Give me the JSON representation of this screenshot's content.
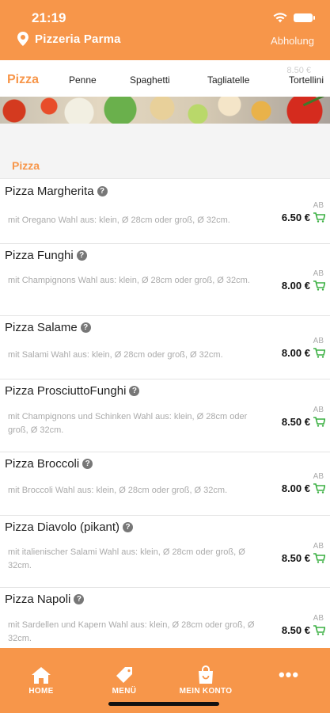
{
  "status_bar": {
    "time": "21:19"
  },
  "header": {
    "restaurant_name": "Pizzeria Parma",
    "pickup_label": "Abholung"
  },
  "tabs": {
    "ghost_price": "8.50 €",
    "items": [
      {
        "label": "Pizza"
      },
      {
        "label": "Penne"
      },
      {
        "label": "Spaghetti"
      },
      {
        "label": "Tagliatelle"
      },
      {
        "label": "Tortellini"
      }
    ]
  },
  "section": {
    "title": "Pizza"
  },
  "menu_items": [
    {
      "name": "Pizza Margherita",
      "description": "mit Oregano Wahl aus: klein, Ø 28cm oder groß, Ø 32cm.",
      "ab": "AB",
      "price": "6.50 €"
    },
    {
      "name": "Pizza Funghi",
      "description": "mit Champignons Wahl aus: klein, Ø 28cm oder groß, Ø 32cm.",
      "ab": "AB",
      "price": "8.00 €"
    },
    {
      "name": "Pizza Salame",
      "description": "mit Salami Wahl aus: klein, Ø 28cm oder groß, Ø 32cm.",
      "ab": "AB",
      "price": "8.00 €"
    },
    {
      "name": "Pizza ProsciuttoFunghi",
      "description": "mit Champignons und Schinken Wahl aus: klein, Ø 28cm oder groß, Ø 32cm.",
      "ab": "AB",
      "price": "8.50 €"
    },
    {
      "name": "Pizza Broccoli",
      "description": "mit Broccoli Wahl aus: klein, Ø 28cm oder groß, Ø 32cm.",
      "ab": "AB",
      "price": "8.00 €"
    },
    {
      "name": "Pizza Diavolo (pikant)",
      "description": "mit italienischer Salami Wahl aus: klein, Ø 28cm oder groß, Ø 32cm.",
      "ab": "AB",
      "price": "8.50 €"
    },
    {
      "name": "Pizza Napoli",
      "description": "mit Sardellen und Kapern Wahl aus: klein, Ø 28cm oder groß, Ø 32cm.",
      "ab": "AB",
      "price": "8.50 €"
    }
  ],
  "bottom_nav": {
    "home_label": "HOME",
    "menu_label": "MENÜ",
    "account_label": "MEIN KONTO",
    "more_label": "•••"
  },
  "colors": {
    "accent": "#f7964a",
    "cart": "#3cb043",
    "text": "#222222",
    "muted": "#aaaaaa"
  },
  "icons": [
    "location-pin-icon",
    "wifi-icon",
    "battery-icon",
    "info-icon",
    "cart-icon",
    "home-icon",
    "tag-icon",
    "shopping-bag-icon",
    "more-icon"
  ]
}
